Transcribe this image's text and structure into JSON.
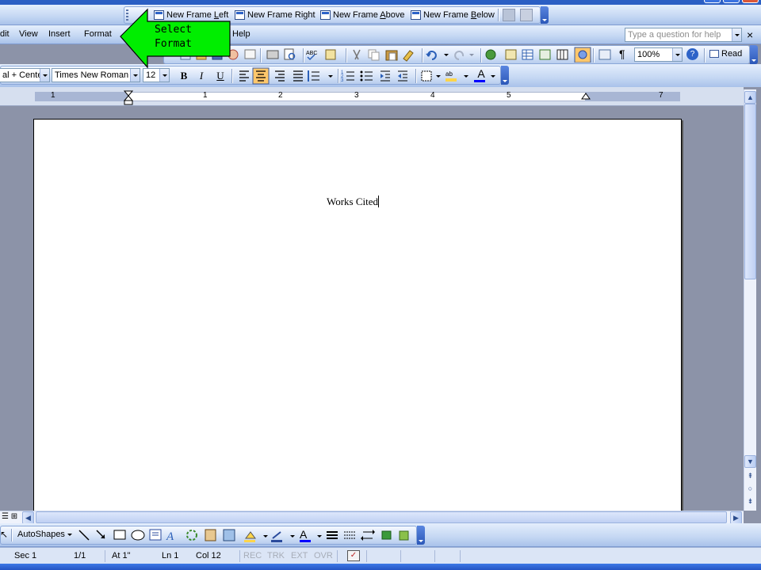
{
  "frames_toolbar": {
    "items": [
      {
        "label": "New Frame Left",
        "access_key": "L"
      },
      {
        "label": "New Frame Right"
      },
      {
        "label": "New Frame Above",
        "access_key": "A"
      },
      {
        "label": "New Frame Below",
        "access_key": "B"
      }
    ]
  },
  "menu": {
    "items": [
      "dit",
      "View",
      "Insert",
      "Format",
      "Help"
    ]
  },
  "help_search": {
    "placeholder": "Type a question for help",
    "close": "×"
  },
  "standard_toolbar": {
    "zoom": "100%",
    "read_label": "Read",
    "paragraph_mark": "¶"
  },
  "formatting_toolbar": {
    "style": "al + Cente",
    "font": "Times New Roman",
    "size": "12",
    "bold": "B",
    "italic": "I",
    "underline": "U",
    "font_color_glyph": "A"
  },
  "ruler": {
    "numbers": [
      "1",
      "1",
      "2",
      "3",
      "4",
      "5",
      "7"
    ]
  },
  "document": {
    "text": "Works Cited"
  },
  "callout": {
    "line1": "Select",
    "line2": "Format",
    "color": "#00ee00"
  },
  "drawing_toolbar": {
    "autoshapes": "AutoShapes"
  },
  "status": {
    "sec": "Sec 1",
    "page": "1/1",
    "at": "At 1\"",
    "ln": "Ln 1",
    "col": "Col 12",
    "rec": "REC",
    "trk": "TRK",
    "ext": "EXT",
    "ovr": "OVR"
  },
  "colors": {
    "toolbar": "#c4d7f3",
    "document_bg": "#8c93a8",
    "highlight": "#ffd54a",
    "font_color": "#0000ff"
  }
}
